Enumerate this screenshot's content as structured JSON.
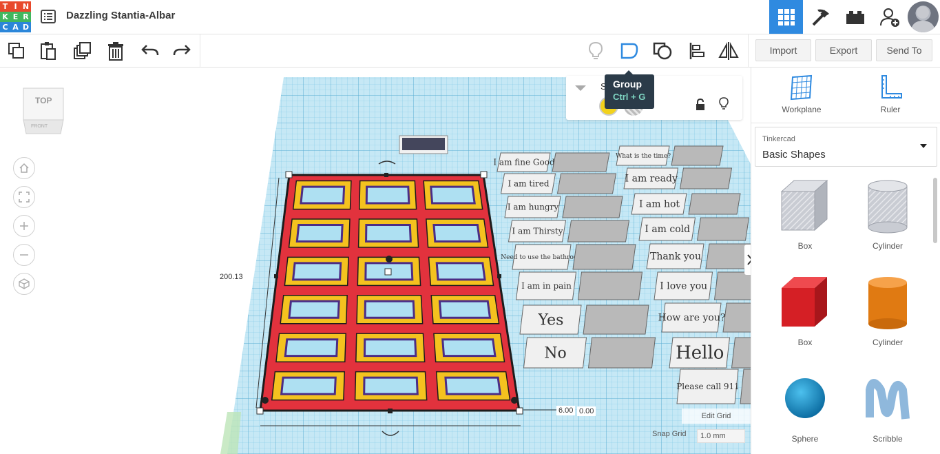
{
  "app": {
    "logo_letters": [
      "T",
      "I",
      "N",
      "K",
      "E",
      "R",
      "C",
      "A",
      "D"
    ],
    "logo_colors": [
      "#e8492c",
      "#e8492c",
      "#e8492c",
      "#41b75e",
      "#41b75e",
      "#41b75e",
      "#2b86d9",
      "#2b86d9",
      "#2b86d9"
    ],
    "title": "Dazzling Stantia-Albar",
    "accent": "#2f8ae0"
  },
  "topnav": {
    "items": [
      "grid-icon",
      "pickaxe-icon",
      "bricks-icon",
      "add-user-icon"
    ],
    "active": "grid-icon"
  },
  "toolbar": {
    "left_icons": [
      "copy-icon",
      "paste-icon",
      "duplicate-icon",
      "trash-icon",
      "undo-icon",
      "redo-icon"
    ],
    "right_icons": [
      "lightbulb-icon",
      "group-icon",
      "ungroup-icon",
      "align-icon",
      "mirror-icon"
    ],
    "import_label": "Import",
    "export_label": "Export",
    "send_to_label": "Send To"
  },
  "tooltip": {
    "title": "Group",
    "shortcut": "Ctrl + G"
  },
  "viewcube": {
    "top_label": "TOP",
    "front_label": "FRONT"
  },
  "view_controls": [
    "home-icon",
    "fit-icon",
    "zoom-in-icon",
    "zoom-out-icon",
    "perspective-icon"
  ],
  "inspector": {
    "label": "S"
  },
  "dimensions": {
    "height": "200.13",
    "elevation": "6.00",
    "offset": "0.00"
  },
  "grid": {
    "edit_grid_label": "Edit Grid",
    "snap_grid_label": "Snap Grid",
    "snap_value": "1.0 mm"
  },
  "labels_left": [
    "I am fine Good",
    "I am tired",
    "I am hungry",
    "I am Thirsty",
    "Need to use the bathroom",
    "I am in pain",
    "Yes",
    "No"
  ],
  "labels_right": [
    "What is the time?",
    "I am ready",
    "I am hot",
    "I am cold",
    "Thank you",
    "I love you",
    "How are you?",
    "Hello",
    "Please call 911"
  ],
  "rightpanel": {
    "workplane_label": "Workplane",
    "ruler_label": "Ruler",
    "library_small": "Tinkercad",
    "library_name": "Basic Shapes",
    "shapes": [
      {
        "name": "Box",
        "color": "#b9bcc4"
      },
      {
        "name": "Cylinder",
        "color": "#b9bcc4"
      },
      {
        "name": "Box",
        "color": "#d51f25"
      },
      {
        "name": "Cylinder",
        "color": "#e07a12"
      },
      {
        "name": "Sphere",
        "color": "#1f90c8"
      },
      {
        "name": "Scribble",
        "color": "#8fb8dc"
      }
    ]
  }
}
